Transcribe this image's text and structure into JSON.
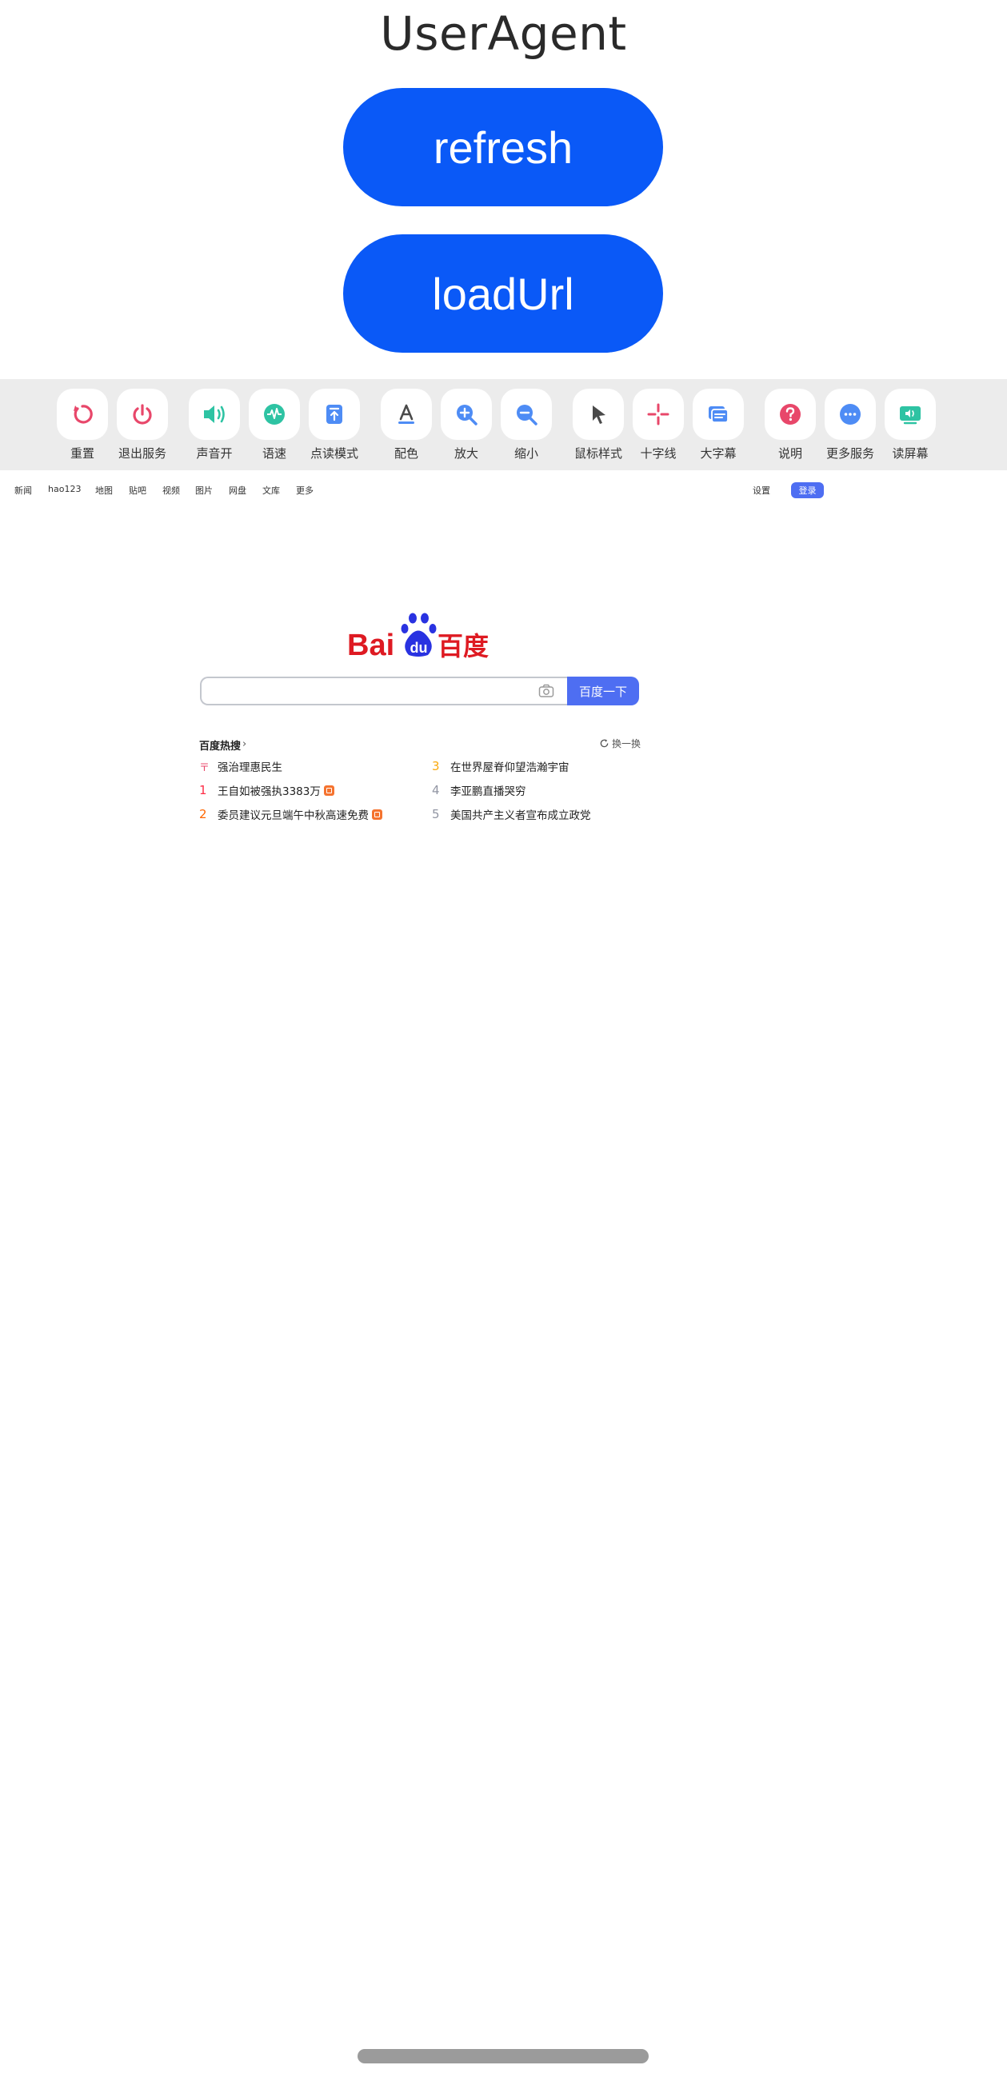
{
  "app": {
    "title": "UserAgent",
    "refresh_label": "refresh",
    "loadurl_label": "loadUrl"
  },
  "toolbar": {
    "items": [
      {
        "label": "重置",
        "icon": "reset-icon",
        "color": "#e8476a"
      },
      {
        "label": "退出服务",
        "icon": "power-icon",
        "color": "#e8476a"
      },
      {
        "label": "声音开",
        "icon": "speaker-icon",
        "color": "#2ec3a3"
      },
      {
        "label": "语速",
        "icon": "speech-rate-icon",
        "color": "#2ec3a3"
      },
      {
        "label": "点读模式",
        "icon": "point-read-icon",
        "color": "#4e8cf5"
      },
      {
        "label": "配色",
        "icon": "color-scheme-icon",
        "color": "#4a4a4a"
      },
      {
        "label": "放大",
        "icon": "zoom-in-icon",
        "color": "#4e8cf5"
      },
      {
        "label": "缩小",
        "icon": "zoom-out-icon",
        "color": "#4e8cf5"
      },
      {
        "label": "鼠标样式",
        "icon": "cursor-icon",
        "color": "#4a4a4a"
      },
      {
        "label": "十字线",
        "icon": "crosshair-icon",
        "color": "#e8476a"
      },
      {
        "label": "大字幕",
        "icon": "big-caption-icon",
        "color": "#4e8cf5"
      },
      {
        "label": "说明",
        "icon": "help-icon",
        "color": "#e8476a"
      },
      {
        "label": "更多服务",
        "icon": "more-icon",
        "color": "#4e8cf5"
      },
      {
        "label": "读屏幕",
        "icon": "read-screen-icon",
        "color": "#2ec3a3"
      }
    ]
  },
  "browser": {
    "nav": [
      "新闻",
      "hao123",
      "地图",
      "贴吧",
      "视频",
      "图片",
      "网盘",
      "文库",
      "更多"
    ],
    "settings": "设置",
    "login": "登录",
    "logo": {
      "left": "Bai",
      "mid": "du",
      "right": "百度"
    },
    "search_placeholder": "",
    "search_button": "百度一下",
    "hot": {
      "title": "百度热搜",
      "refresh": "换一换",
      "left": [
        {
          "rank": "〒",
          "text": "强治理惠民生",
          "badge": false
        },
        {
          "rank": "1",
          "text": "王自如被强执3383万",
          "badge": true
        },
        {
          "rank": "2",
          "text": "委员建议元旦端午中秋高速免费",
          "badge": true
        }
      ],
      "right": [
        {
          "rank": "3",
          "text": "在世界屋脊仰望浩瀚宇宙"
        },
        {
          "rank": "4",
          "text": "李亚鹏直播哭穷"
        },
        {
          "rank": "5",
          "text": "美国共产主义者宣布成立政党"
        }
      ],
      "rank_colors": {
        "top": "#e8476a",
        "1": "#fe2d46",
        "2": "#f60",
        "3": "#faa90e",
        "other": "#9195a3"
      }
    }
  }
}
